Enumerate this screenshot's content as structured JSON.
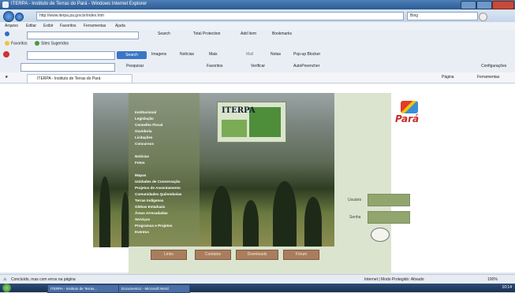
{
  "window": {
    "title": "ITERPA - Instituto de Terras do Pará - Windows Internet Explorer"
  },
  "address": {
    "url": "http://www.iterpa.pa.gov.br/index.htm",
    "search_placeholder": "Bing"
  },
  "menu": [
    "Arquivo",
    "Editar",
    "Exibir",
    "Favoritos",
    "Ferramentas",
    "Ajuda"
  ],
  "toolbar1": {
    "search_label": "Search",
    "protection": "Total Protection",
    "add_items": [
      "Add Item",
      "Bookmarks"
    ]
  },
  "favbar": {
    "items": [
      "Favoritos",
      "Sites Sugeridos"
    ]
  },
  "toolbar2": {
    "search_button": "Search",
    "items": [
      "Imagens",
      "Notícias",
      "Mais",
      "Mail",
      "Notas",
      "Pop-up Blocker"
    ]
  },
  "toolbar3": {
    "items": [
      "Pesquisar",
      "Favoritos",
      "Verificar",
      "AutoPreencher"
    ],
    "right": "Configurações"
  },
  "tab": {
    "label": "ITERPA - Instituto de Terras do Pará",
    "right_tools": [
      "Página",
      "Ferramentas"
    ]
  },
  "page": {
    "logo_text": "ITERPA",
    "menu_items": [
      "Institucional",
      "Legislação",
      "Conselho Fiscal",
      "Ouvidoria",
      "Licitações",
      "Concursos",
      "Notícias",
      "Fotos",
      "Mapas",
      "Unidades de Conservação",
      "Projetos de Assentamento",
      "Comunidades Quilombolas",
      "Terras Indígenas",
      "Glebas Estaduais",
      "Áreas Arrecadadas",
      "Serviços",
      "Programas e Projetos",
      "Eventos"
    ],
    "state_logo": "Pará",
    "login": {
      "user_label": "Usuário",
      "password_label": "Senha"
    },
    "buttons": [
      "Links",
      "Contatos",
      "Downloads",
      "Fórum"
    ]
  },
  "status": {
    "left": "Concluído, mas com erros na página",
    "zone": "Internet | Modo Protegido: Ativado",
    "zoom": "100%"
  },
  "taskbar": {
    "items": [
      "ITERPA - Instituto de Terras...",
      "Documento1 - Microsoft Word"
    ],
    "clock": "10:14"
  }
}
